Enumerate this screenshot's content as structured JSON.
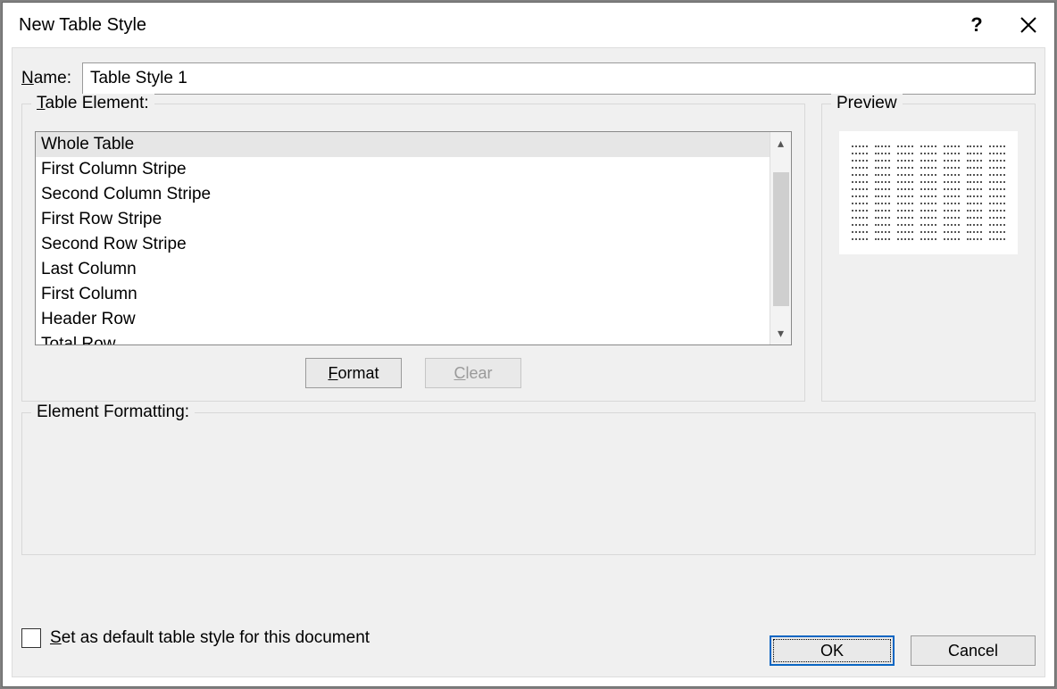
{
  "dialog": {
    "title": "New Table Style"
  },
  "name": {
    "label_pre": "N",
    "label_post": "ame:",
    "value": "Table Style 1"
  },
  "table_element": {
    "legend_pre": "T",
    "legend_post": "able Element:",
    "items": [
      "Whole Table",
      "First Column Stripe",
      "Second Column Stripe",
      "First Row Stripe",
      "Second Row Stripe",
      "Last Column",
      "First Column",
      "Header Row",
      "Total Row"
    ],
    "selected_index": 0,
    "format_btn_pre": "F",
    "format_btn_post": "ormat",
    "clear_btn_pre": "C",
    "clear_btn_post": "lear"
  },
  "preview": {
    "legend": "Preview",
    "rows": 7,
    "cols": 7
  },
  "element_formatting": {
    "legend": "Element Formatting:"
  },
  "default_checkbox": {
    "label_pre": "S",
    "label_post": "et as default table style for this document",
    "checked": false
  },
  "buttons": {
    "ok": "OK",
    "cancel": "Cancel"
  }
}
